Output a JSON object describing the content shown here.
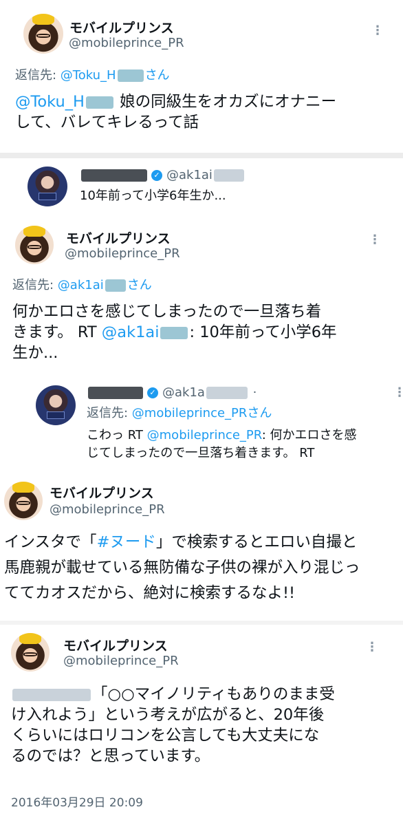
{
  "tweet1": {
    "display_name": "モバイルプリンス",
    "handle": "@mobileprince_PR",
    "reply_label": "返信先: ",
    "reply_handle": "@Toku_H",
    "reply_suffix": "さん",
    "mention": "@Toku_H",
    "body_line1": "娘の同級生をオカズにオナニー",
    "body_line2": "して、バレてキレるって話",
    "more_icon": "ellipsis-vertical-icon"
  },
  "quote1": {
    "handle": "@ak1ai",
    "text": "10年前って小学6年生か..."
  },
  "tweet2": {
    "display_name": "モバイルプリンス",
    "handle": "@mobileprince_PR",
    "reply_label": "返信先: ",
    "reply_handle": "@ak1ai",
    "reply_suffix": "さん",
    "body_line1": "何かエロさを感じてしまったので一旦落ち着",
    "body_line2a": "きます。 RT ",
    "body_mention": "@ak1ai",
    "body_line2b": ": 10年前って小学6年",
    "body_line3": "生か..."
  },
  "reply2": {
    "handle": "@ak1a",
    "dot": "·",
    "reply_label": "返信先: ",
    "reply_handle": "@mobileprince_PRさん",
    "text_line1a": "こわっ RT ",
    "text_mention": "@mobileprince_PR",
    "text_line1b": ": 何かエロさを感",
    "text_line2": "じてしまったので一旦落ち着きます。 RT"
  },
  "tweet3": {
    "display_name": "モバイルプリンス",
    "handle": "@mobileprince_PR",
    "body_line1a": "インスタで「",
    "hashtag": "#ヌード",
    "body_line1b": "」で検索するとエロい自撮と",
    "body_line2": "馬鹿親が載せている無防備な子供の裸が入り混じっ",
    "body_line3": "ててカオスだから、絶対に検索するなよ!!"
  },
  "tweet4": {
    "display_name": "モバイルプリンス",
    "handle": "@mobileprince_PR",
    "body_line1": "「○○マイノリティもありのまま受",
    "body_line2": "け入れよう」という考えが広がると、20年後",
    "body_line3": "くらいにはロリコンを公言しても大丈夫にな",
    "body_line4": "るのでは？と思っています。",
    "timestamp": "2016年03月29日 20:09"
  },
  "colors": {
    "link": "#1d9bf0",
    "secondary": "#536471",
    "text": "#0f1419"
  }
}
